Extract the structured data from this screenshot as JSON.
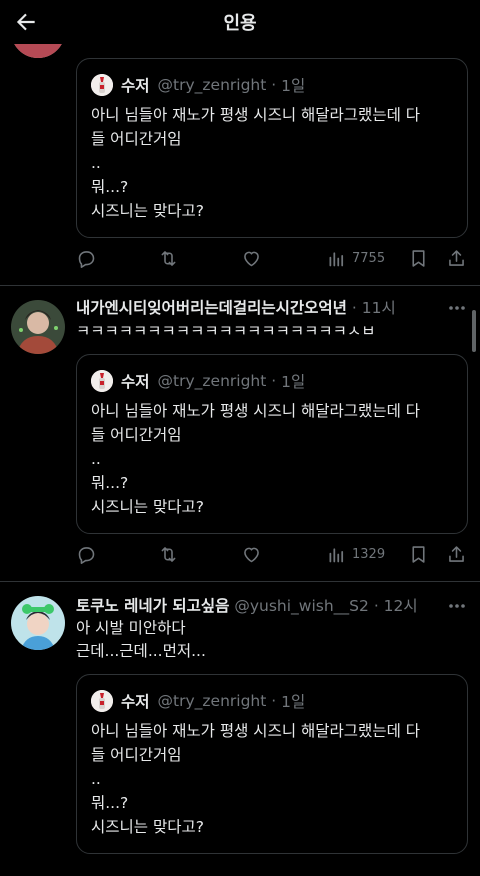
{
  "header": {
    "title": "인용"
  },
  "quoted": {
    "name": "수저",
    "handle": "@try_zenright",
    "time": "1일",
    "text": "아니 님들아 재노가 평생 시즈니 해달라그랬는데 다\n들 어디간거임\n..\n뭐...?\n시즈니는 맞다고?"
  },
  "tweets": [
    {
      "views": "7755"
    },
    {
      "name": "내가엔시티잊어버리는데걸리는시간오억년",
      "time": "11시",
      "text": "ㅋㅋㅋㅋㅋㅋㅋㅋㅋㅋㅋㅋㅋㅋㅋㅋㅋㅋㅋㅅㅂ",
      "views": "1329"
    },
    {
      "name": "토쿠노 레네가 되고싶음",
      "handle": "@yushi_wish__S2",
      "time": "12시",
      "text": "아 시발 미안하다\n근데...근데...먼저..."
    }
  ],
  "colors": {
    "background": "#000000",
    "text": "#e7e9ea",
    "muted": "#71767b",
    "border": "#2f3336"
  },
  "icons": [
    "arrow-left-icon",
    "more-icon",
    "reply-icon",
    "retweet-icon",
    "like-icon",
    "views-icon",
    "bookmark-icon",
    "share-icon"
  ]
}
